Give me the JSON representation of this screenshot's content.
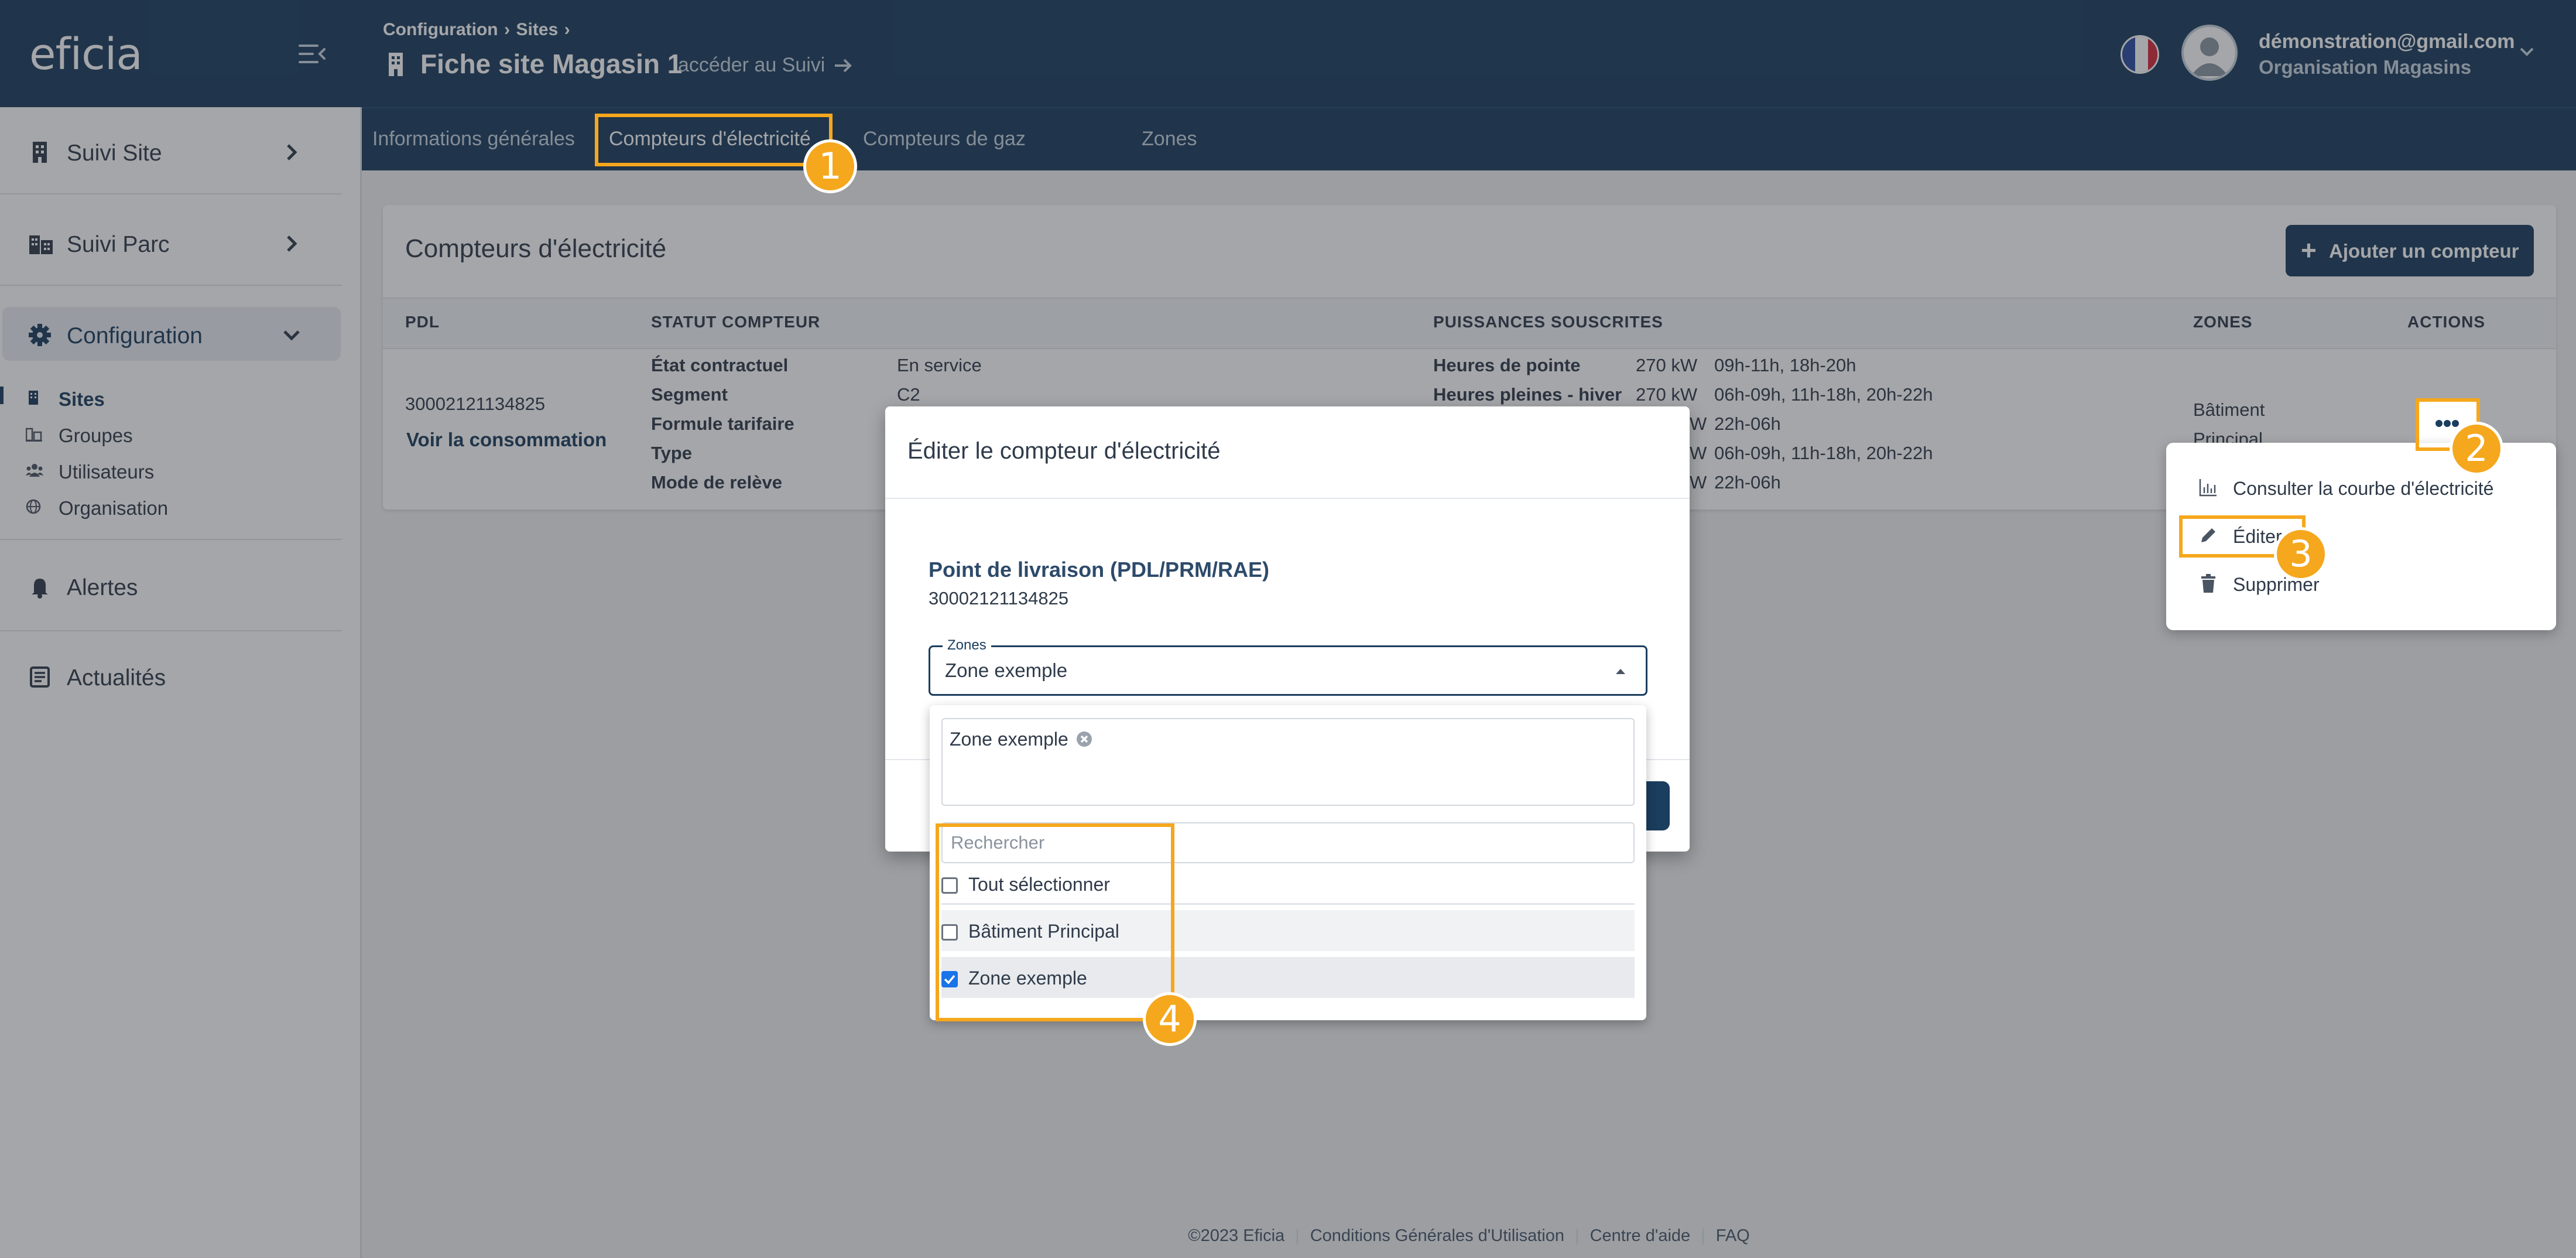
{
  "brand": {
    "logo_text": "eficia"
  },
  "sidebar": {
    "items": [
      {
        "label": "Suivi Site",
        "icon": "building-icon"
      },
      {
        "label": "Suivi Parc",
        "icon": "buildings-icon"
      },
      {
        "label": "Configuration",
        "icon": "gear-icon"
      }
    ],
    "config_sub": [
      {
        "label": "Sites",
        "icon": "building-icon",
        "active": true
      },
      {
        "label": "Groupes",
        "icon": "group-icon"
      },
      {
        "label": "Utilisateurs",
        "icon": "users-icon"
      },
      {
        "label": "Organisation",
        "icon": "globe-icon"
      }
    ],
    "alertes": {
      "label": "Alertes",
      "icon": "bell-icon"
    },
    "actualites": {
      "label": "Actualités",
      "icon": "news-icon"
    }
  },
  "header": {
    "breadcrumb": [
      "Configuration",
      "Sites"
    ],
    "title": "Fiche site Magasin 1",
    "suivi_link": "accéder au Suivi",
    "user": {
      "email": "démonstration@gmail.com",
      "org": "Organisation Magasins"
    }
  },
  "tabs": [
    {
      "label": "Informations générales"
    },
    {
      "label": "Compteurs d'électricité",
      "active": true
    },
    {
      "label": "Compteurs de gaz"
    },
    {
      "label": "Zones"
    }
  ],
  "panel": {
    "title": "Compteurs d'électricité",
    "add_button": "Ajouter un compteur",
    "add_icon": "+",
    "columns": [
      "PDL",
      "STATUT COMPTEUR",
      "PUISSANCES SOUSCRITES",
      "ZONES",
      "ACTIONS"
    ],
    "row": {
      "pdl": "30002121134825",
      "voir_conso": "Voir la consommation",
      "statut": [
        {
          "label": "État contractuel",
          "value": "En service"
        },
        {
          "label": "Segment",
          "value": "C2"
        },
        {
          "label": "Formule tarifaire",
          "value": ""
        },
        {
          "label": "Type",
          "value": ""
        },
        {
          "label": "Mode de relève",
          "value": ""
        }
      ],
      "puissances": [
        {
          "label": "Heures de pointe",
          "kw": "270 kW",
          "hours": "09h-11h, 18h-20h"
        },
        {
          "label": "Heures pleines - hiver",
          "kw": "270 kW",
          "hours": "06h-09h, 11h-18h, 20h-22h"
        },
        {
          "label": "",
          "kw": "W",
          "hours": "22h-06h"
        },
        {
          "label": "",
          "kw": "W",
          "hours": "06h-09h, 11h-18h, 20h-22h"
        },
        {
          "label": "",
          "kw": "W",
          "hours": "22h-06h"
        }
      ],
      "zones": [
        "Bâtiment",
        "Principal"
      ]
    }
  },
  "modal": {
    "title": "Éditer le compteur d'électricité",
    "pdl_label": "Point de livraison (PDL/PRM/RAE)",
    "pdl_value": "30002121134825",
    "zones_legend": "Zones",
    "zones_value": "Zone exemple",
    "dropdown": {
      "chip": "Zone exemple",
      "search_placeholder": "Rechercher",
      "select_all": "Tout sélectionner",
      "options": [
        {
          "label": "Bâtiment Principal",
          "checked": false
        },
        {
          "label": "Zone exemple",
          "checked": true
        }
      ]
    }
  },
  "actions_menu": {
    "items": [
      {
        "label": "Consulter la courbe d'électricité",
        "icon": "chart-icon"
      },
      {
        "label": "Éditer",
        "icon": "pencil-icon"
      },
      {
        "label": "Supprimer",
        "icon": "trash-icon"
      }
    ]
  },
  "badges": [
    "1",
    "2",
    "3",
    "4"
  ],
  "footer": {
    "copyright": "©2023 Eficia",
    "links": [
      "Conditions Générales d'Utilisation",
      "Centre d'aide",
      "FAQ"
    ]
  },
  "colors": {
    "primary": "#1b3d5e",
    "accent": "#f5a71d",
    "checkbox": "#1a73e8"
  }
}
